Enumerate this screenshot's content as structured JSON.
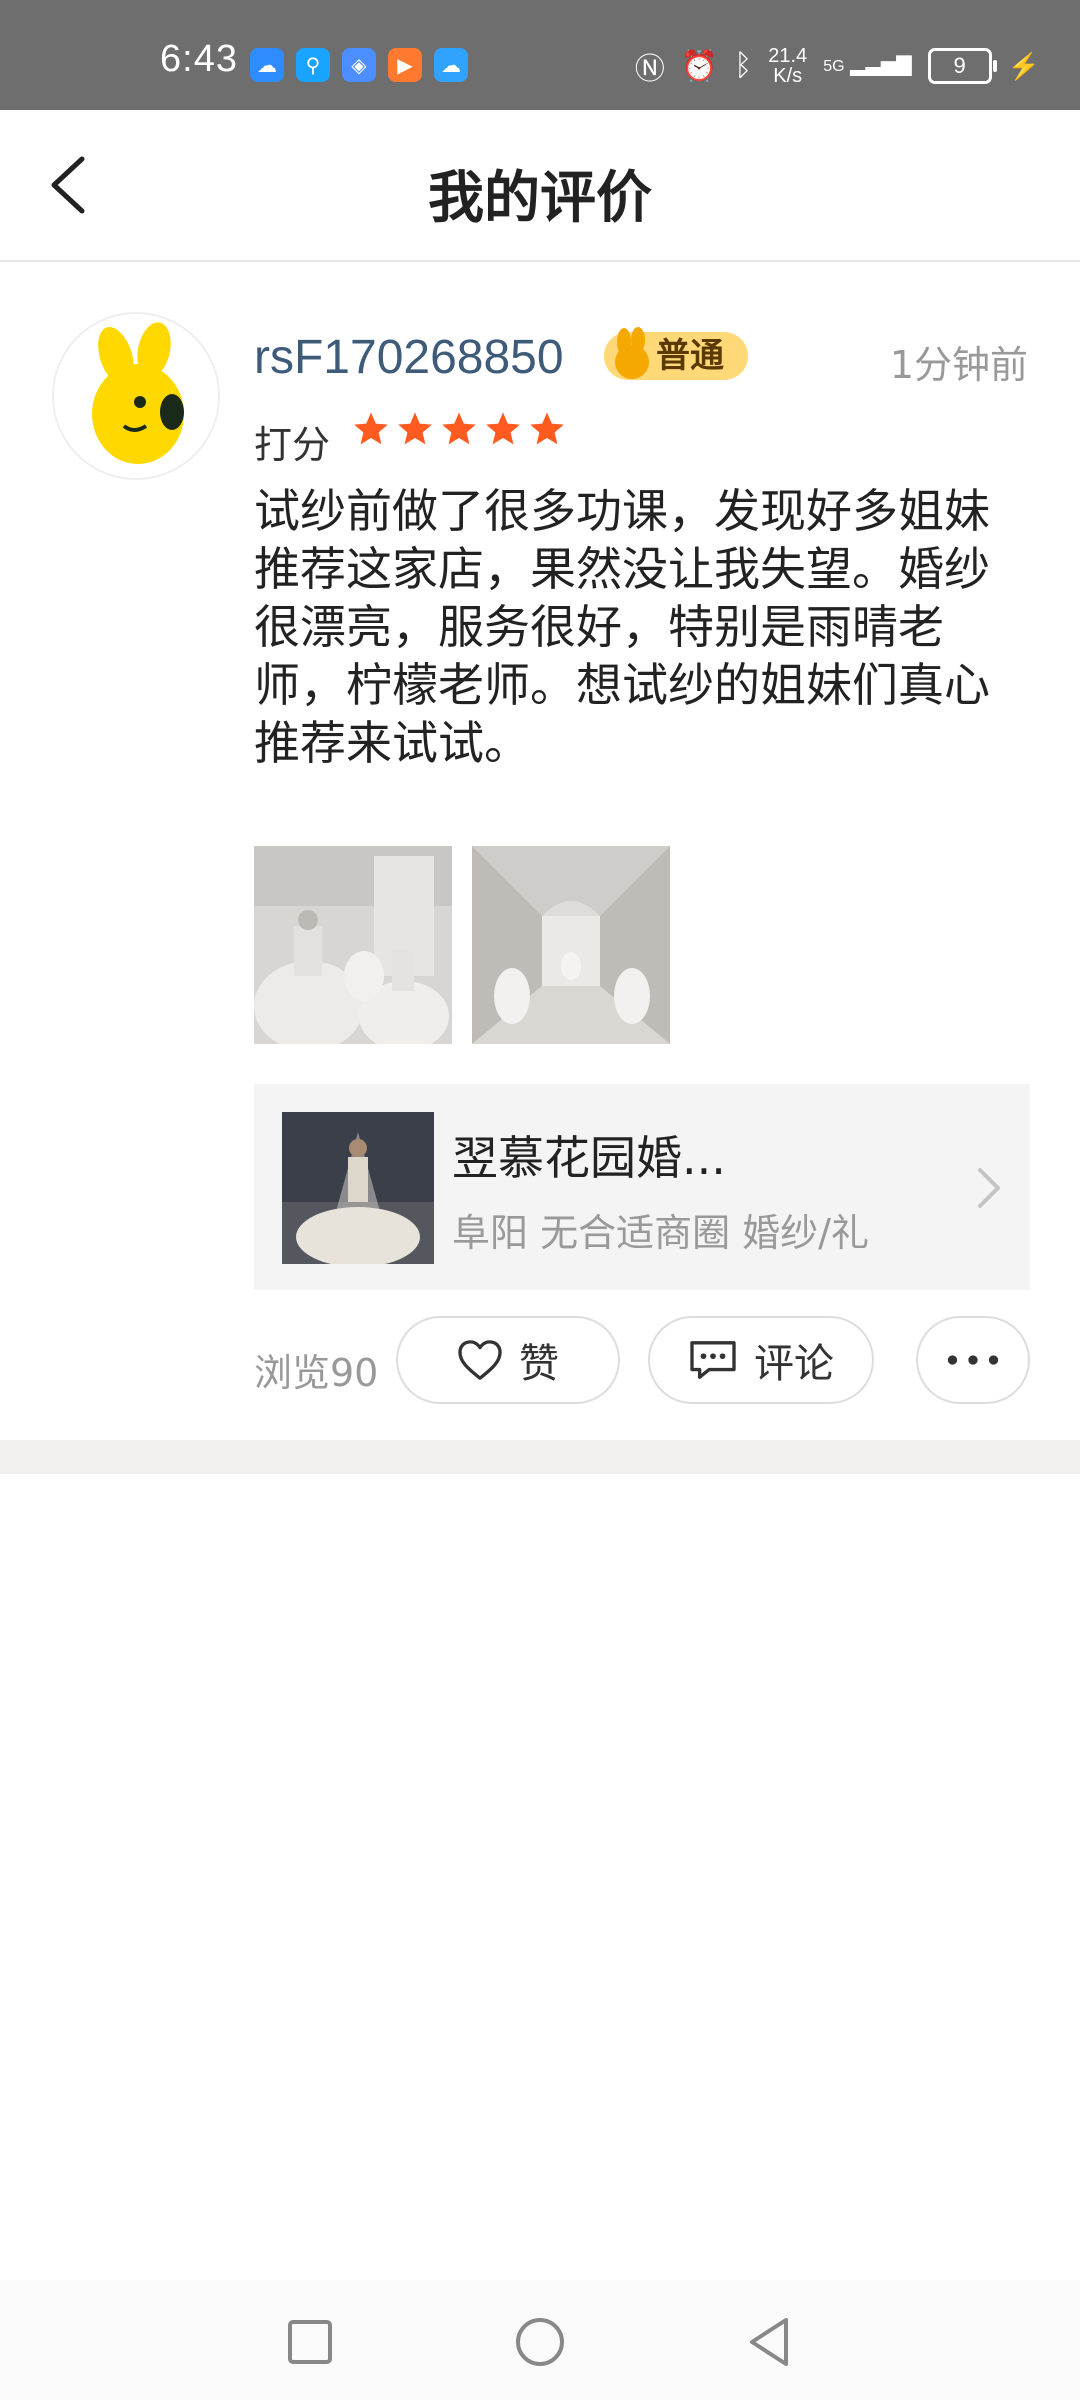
{
  "status_bar": {
    "time": "6:43",
    "network_speed_value": "21.4",
    "network_speed_unit": "K/s",
    "signal_label": "5G",
    "battery": "9"
  },
  "header": {
    "title": "我的评价"
  },
  "review": {
    "username": "rsF170268850",
    "badge": "普通",
    "time": "1分钟前",
    "rating_label": "打分",
    "rating": 5,
    "content": "试纱前做了很多功课，发现好多姐妹推荐这家店，果然没让我失望。婚纱很漂亮，服务很好，特别是雨晴老师，柠檬老师。想试纱的姐妹们真心推荐来试试。",
    "store": {
      "name": "翌慕花园婚...",
      "subtitle": "阜阳 无合适商圈 婚纱/礼"
    },
    "views": "浏览90",
    "like_label": "赞",
    "comment_label": "评论"
  },
  "colors": {
    "username": "#3f5b7a",
    "star": "#ff5a1f",
    "badge_bg": "#ffd977"
  }
}
